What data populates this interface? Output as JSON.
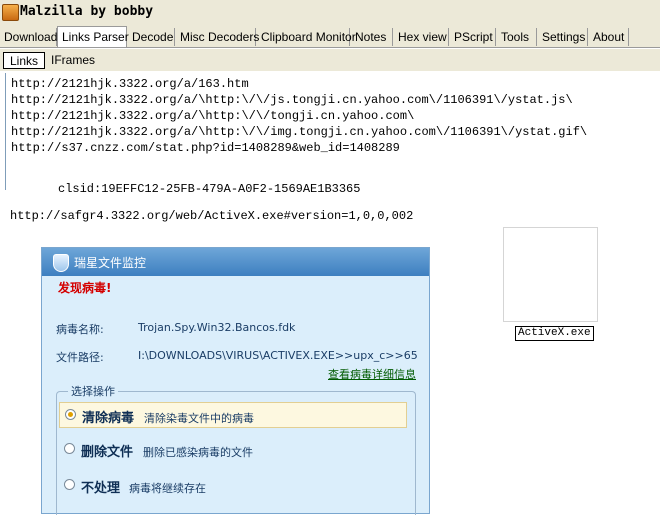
{
  "window": {
    "title": "Malzilla by bobby"
  },
  "tabs": [
    {
      "label": "Download"
    },
    {
      "label": "Links Parser"
    },
    {
      "label": "Decode"
    },
    {
      "label": "Misc Decoders"
    },
    {
      "label": "Clipboard Monitor"
    },
    {
      "label": "Notes"
    },
    {
      "label": "Hex view"
    },
    {
      "label": "PScript"
    },
    {
      "label": "Tools"
    },
    {
      "label": "Settings"
    },
    {
      "label": "About"
    }
  ],
  "subtabs": [
    {
      "label": "Links"
    },
    {
      "label": "IFrames"
    }
  ],
  "links": [
    "http://2121hjk.3322.org/a/163.htm",
    "http://2121hjk.3322.org/a/\\http:\\/\\/js.tongji.cn.yahoo.com\\/1106391\\/ystat.js\\",
    "http://2121hjk.3322.org/a/\\http:\\/\\/tongji.cn.yahoo.com\\",
    "http://2121hjk.3322.org/a/\\http:\\/\\/img.tongji.cn.yahoo.com\\/1106391\\/ystat.gif\\",
    "http://s37.cnzz.com/stat.php?id=1408289&web_id=1408289"
  ],
  "clsid_text": "clsid:19EFFC12-25FB-479A-A0F2-1569AE1B3365",
  "activex_url": "http://safgr4.3322.org/web/ActiveX.exe#version=1,0,0,002",
  "popup": {
    "title": "瑞星文件监控",
    "found": "发现病毒!",
    "virus_name_label": "病毒名称:",
    "virus_name": "Trojan.Spy.Win32.Bancos.fdk",
    "file_path_label": "文件路径:",
    "file_path": "I:\\DOWNLOADS\\VIRUS\\ACTIVEX.EXE>>upx_c>>65",
    "details_link": "查看病毒详细信息",
    "group_title": "选择操作",
    "options": [
      {
        "name": "清除病毒",
        "desc": "清除染毒文件中的病毒"
      },
      {
        "name": "删除文件",
        "desc": "删除已感染病毒的文件"
      },
      {
        "name": "不处理",
        "desc": "病毒将继续存在"
      }
    ]
  },
  "image_caption": "ActiveX.exe"
}
